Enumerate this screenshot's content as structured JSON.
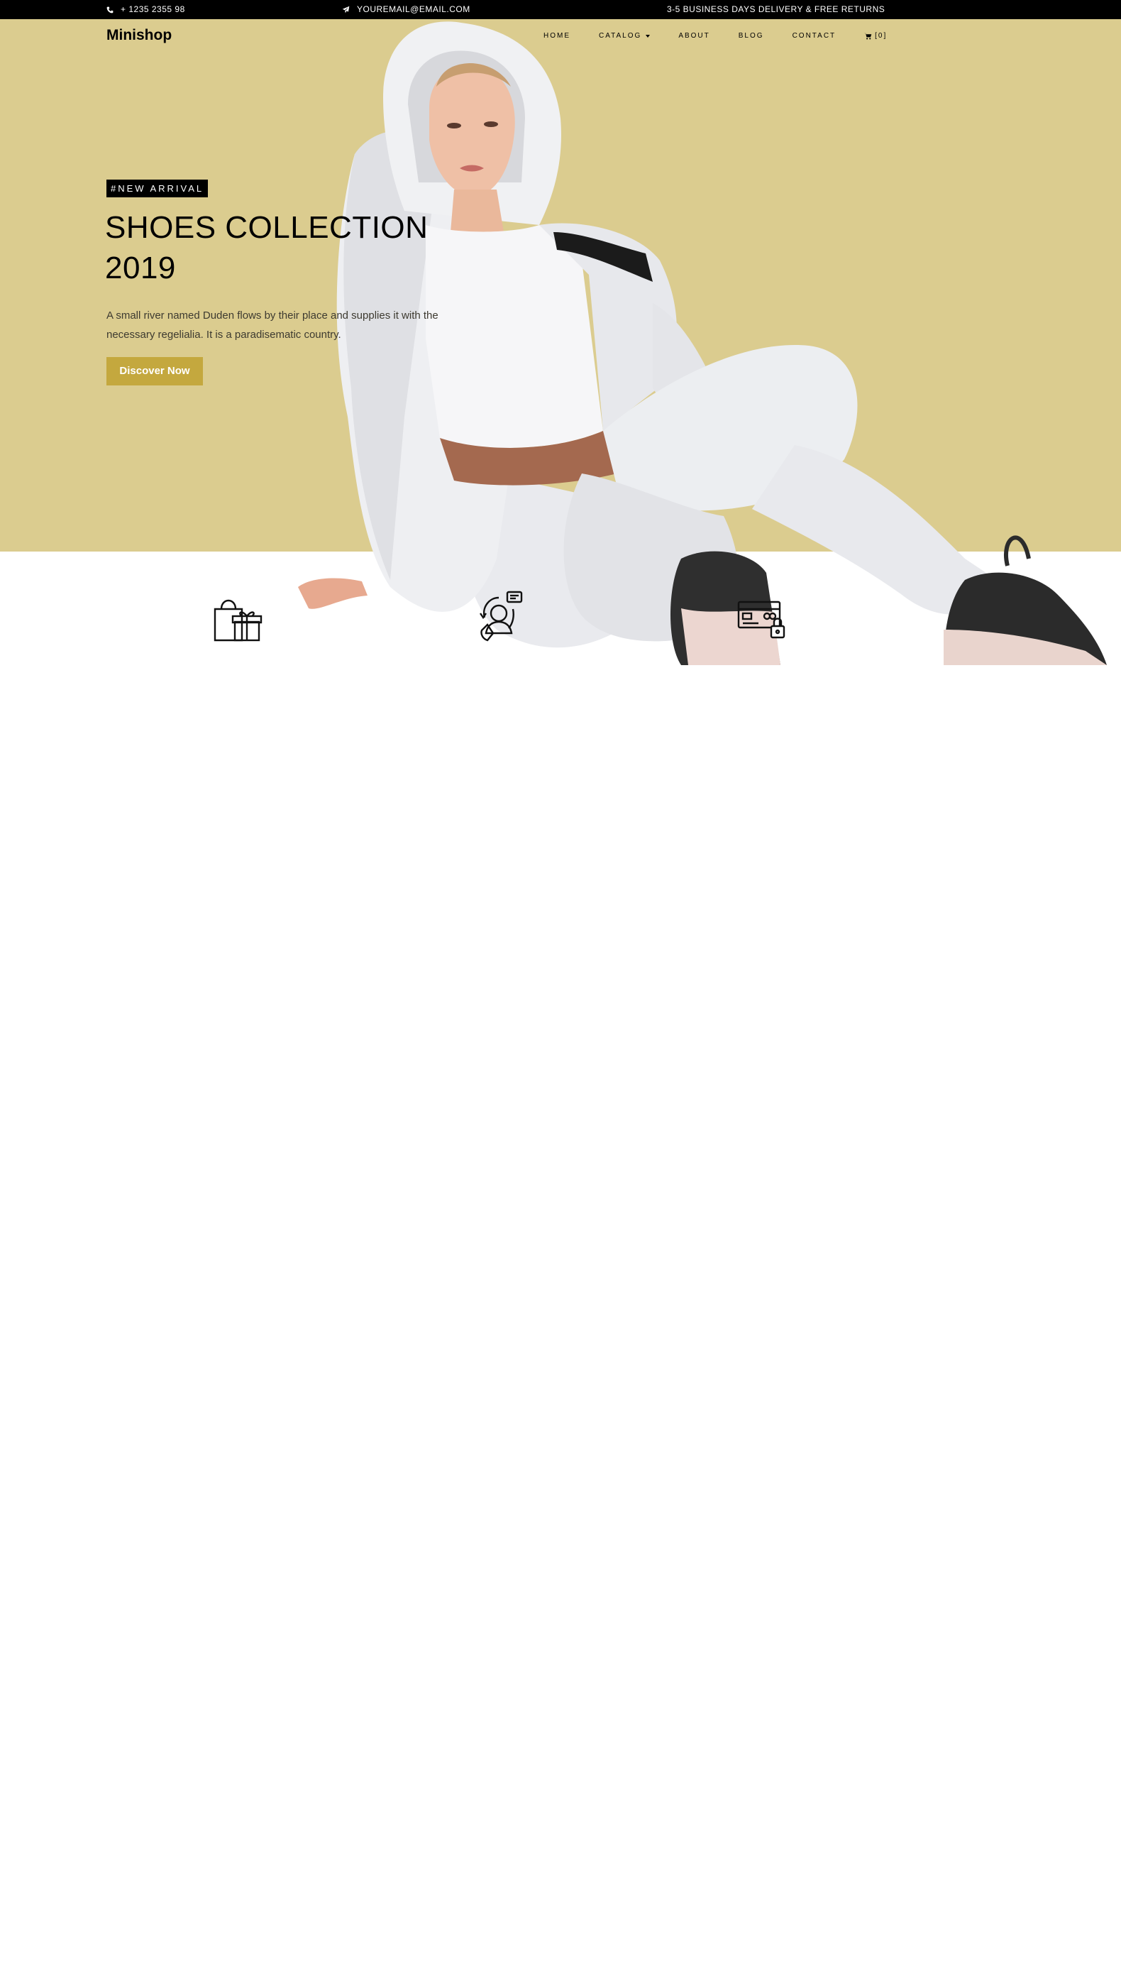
{
  "topbar": {
    "phone": "+ 1235 2355 98",
    "email": "YOUREMAIL@EMAIL.COM",
    "delivery": "3-5 BUSINESS DAYS DELIVERY & FREE RETURNS"
  },
  "brand": "Minishop",
  "nav": {
    "home": "HOME",
    "catalog": "CATALOG",
    "about": "ABOUT",
    "blog": "BLOG",
    "contact": "CONTACT",
    "cart": "[0]"
  },
  "hero": {
    "badge": "#NEW ARRIVAL",
    "title": "SHOES COLLECTION 2019",
    "description": "A small river named Duden flows by their place and supplies it with the necessary regelialia. It is a paradisematic country.",
    "cta": "Discover Now"
  },
  "colors": {
    "hero_bg": "#dbcc8f",
    "accent": "#c4a83e",
    "topbar_bg": "#000000"
  },
  "services": {
    "icons": [
      "shopping-bag-gift-icon",
      "customer-support-icon",
      "payment-card-lock-icon"
    ]
  }
}
